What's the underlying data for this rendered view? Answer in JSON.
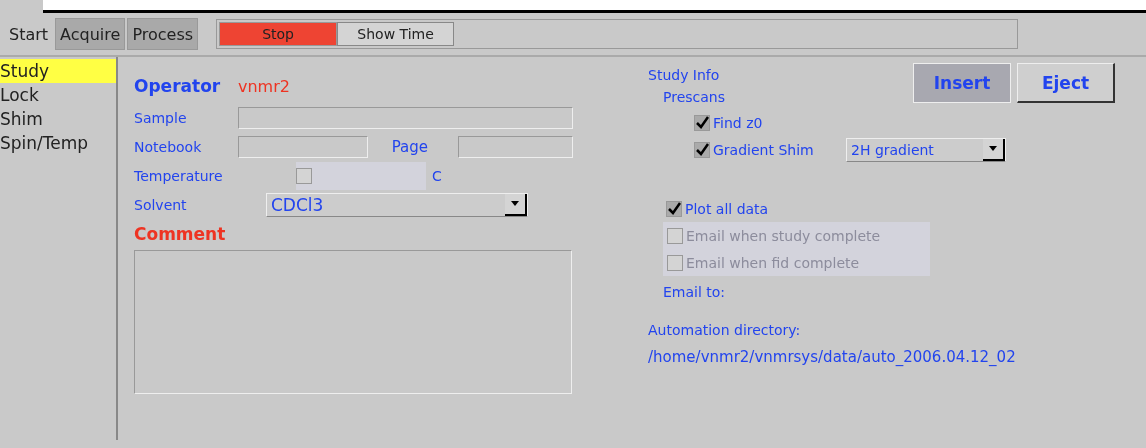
{
  "tabs": [
    {
      "label": "Start",
      "selected": true
    },
    {
      "label": "Acquire",
      "selected": false
    },
    {
      "label": "Process",
      "selected": false
    }
  ],
  "toolbar": {
    "stop": "Stop",
    "show_time": "Show Time"
  },
  "sidebar": {
    "items": [
      {
        "label": "Study",
        "selected": true
      },
      {
        "label": "Lock",
        "selected": false
      },
      {
        "label": "Shim",
        "selected": false
      },
      {
        "label": "Spin/Temp",
        "selected": false
      }
    ]
  },
  "form": {
    "operator_label": "Operator",
    "operator": "vnmr2",
    "sample_label": "Sample",
    "notebook_label": "Notebook",
    "page_label": "Page",
    "temperature_label": "Temperature",
    "temperature_checked": false,
    "temperature_unit": "C",
    "solvent_label": "Solvent",
    "solvent": "CDCl3",
    "comment_label": "Comment"
  },
  "study_info": {
    "title": "Study Info",
    "buttons": [
      {
        "label": "Insert",
        "pressed": true
      },
      {
        "label": "Eject",
        "pressed": false
      }
    ],
    "prescans_label": "Prescans",
    "find_z0": {
      "label": "Find z0",
      "checked": true
    },
    "gradient_shim": {
      "label": "Gradient Shim",
      "checked": true,
      "option": "2H gradient"
    },
    "options": [
      {
        "label": "Plot all data",
        "checked": true,
        "disabled": false
      },
      {
        "label": "Email when study complete",
        "checked": false,
        "disabled": true
      },
      {
        "label": "Email when fid complete",
        "checked": false,
        "disabled": true
      }
    ],
    "email_to_label": "Email to:",
    "automation_label": "Automation directory:",
    "automation_path": "/home/vnmr2/vnmrsys/data/auto_2006.04.12_02"
  }
}
